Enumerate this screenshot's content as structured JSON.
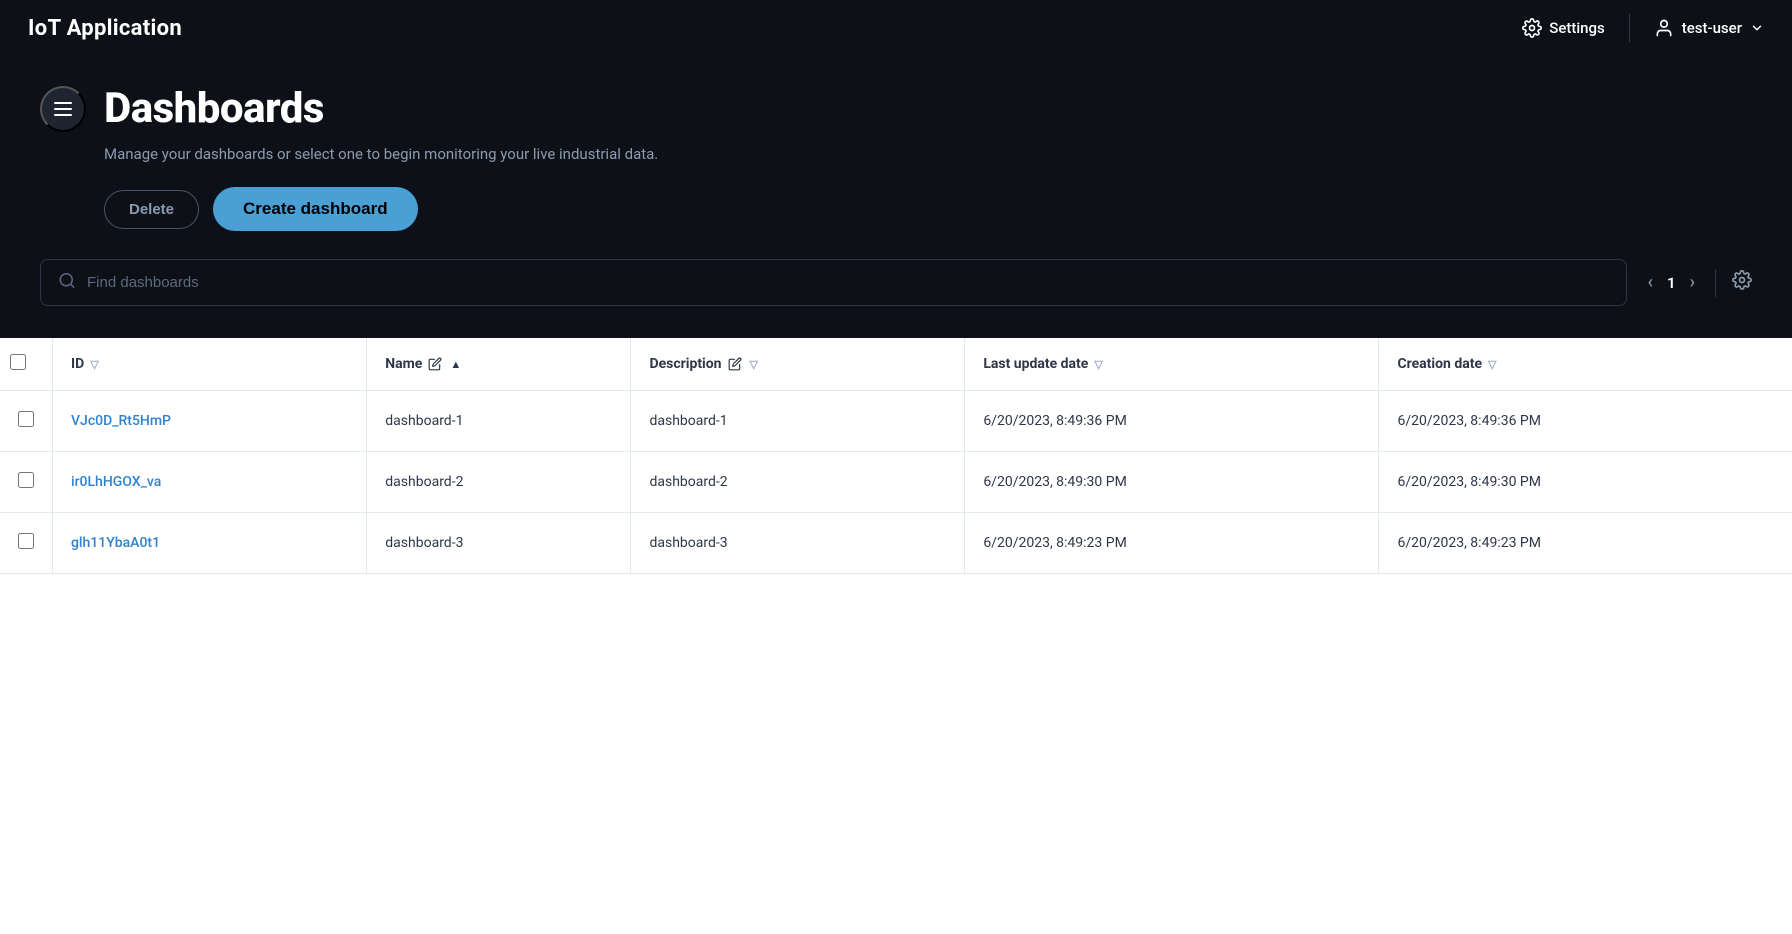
{
  "app": {
    "title": "IoT Application"
  },
  "topbar": {
    "settings_label": "Settings",
    "user_label": "test-user"
  },
  "header": {
    "page_title": "Dashboards",
    "subtitle": "Manage your dashboards or select one to begin monitoring your live industrial data.",
    "delete_label": "Delete",
    "create_label": "Create dashboard",
    "search_placeholder": "Find dashboards"
  },
  "pagination": {
    "current_page": "1"
  },
  "table": {
    "columns": [
      {
        "key": "id",
        "label": "ID",
        "sortable": true,
        "sort_dir": "desc"
      },
      {
        "key": "name",
        "label": "Name",
        "sortable": true,
        "sort_dir": "asc",
        "editable": true
      },
      {
        "key": "description",
        "label": "Description",
        "sortable": true,
        "sort_dir": "desc",
        "editable": true
      },
      {
        "key": "last_update",
        "label": "Last update date",
        "sortable": true,
        "sort_dir": "desc"
      },
      {
        "key": "creation_date",
        "label": "Creation date",
        "sortable": true,
        "sort_dir": "desc"
      }
    ],
    "rows": [
      {
        "id": "VJc0D_Rt5HmP",
        "name": "dashboard-1",
        "description": "dashboard-1",
        "last_update": "6/20/2023, 8:49:36 PM",
        "creation_date": "6/20/2023, 8:49:36 PM"
      },
      {
        "id": "ir0LhHGOX_va",
        "name": "dashboard-2",
        "description": "dashboard-2",
        "last_update": "6/20/2023, 8:49:30 PM",
        "creation_date": "6/20/2023, 8:49:30 PM"
      },
      {
        "id": "glh11YbaA0t1",
        "name": "dashboard-3",
        "description": "dashboard-3",
        "last_update": "6/20/2023, 8:49:23 PM",
        "creation_date": "6/20/2023, 8:49:23 PM"
      }
    ]
  }
}
